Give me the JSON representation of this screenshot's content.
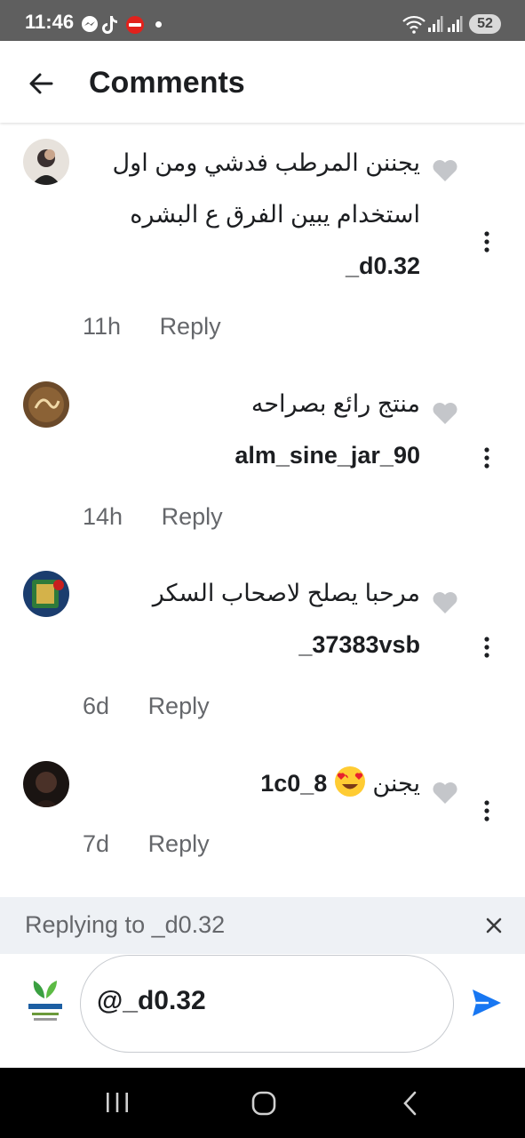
{
  "status_bar": {
    "time": "11:46",
    "battery": "52",
    "notification_icons": [
      "messenger-icon",
      "tiktok-icon",
      "app-icon",
      "dot-icon"
    ],
    "system_icons": [
      "wifi-icon",
      "signal-icon",
      "signal-icon",
      "battery-icon"
    ]
  },
  "header": {
    "back_icon": "arrow-left-icon",
    "title": "Comments"
  },
  "comments": [
    {
      "username": "_d0.32",
      "text": "يجننن المرطب فدشي ومن اول استخدام يبين الفرق ع البشره",
      "time": "11h",
      "reply_label": "Reply"
    },
    {
      "username": "alm_sine_jar_90",
      "text": "منتج رائع بصراحه",
      "time": "14h",
      "reply_label": "Reply"
    },
    {
      "username": "_37383vsb",
      "text": "مرحبا يصلح لاصحاب السكر",
      "time": "6d",
      "reply_label": "Reply"
    },
    {
      "username": "1c0_8",
      "text": "يجنن",
      "emoji": "heart-eyes-emoji",
      "time": "7d",
      "reply_label": "Reply"
    }
  ],
  "replying": {
    "text": "Replying to _d0.32",
    "close_icon": "close-icon"
  },
  "composer": {
    "value": "@_d0.32",
    "send_icon": "send-icon"
  },
  "colors": {
    "accent": "#1877f2",
    "status_bar": "#5f5f5f",
    "reply_bar": "#eef1f5",
    "meta_text": "#65676b"
  }
}
